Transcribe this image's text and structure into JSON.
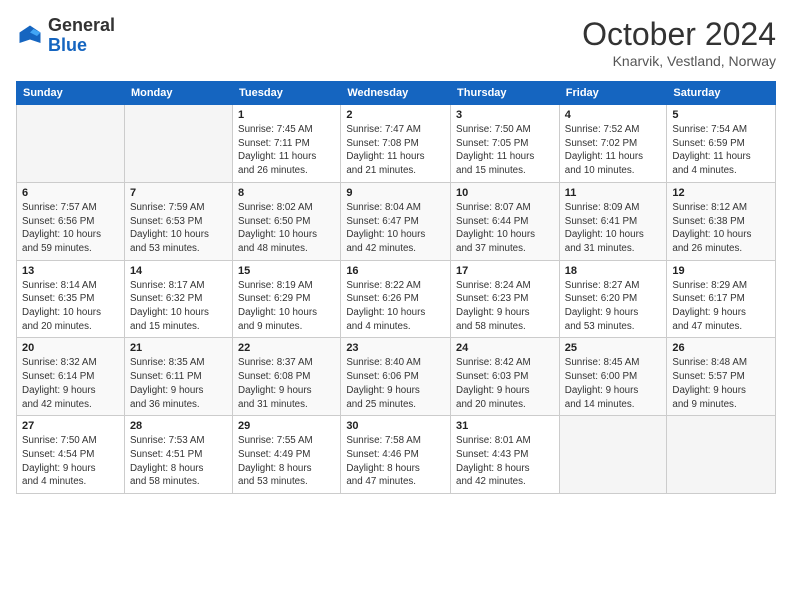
{
  "logo": {
    "line1": "General",
    "line2": "Blue"
  },
  "header": {
    "month": "October 2024",
    "location": "Knarvik, Vestland, Norway"
  },
  "weekdays": [
    "Sunday",
    "Monday",
    "Tuesday",
    "Wednesday",
    "Thursday",
    "Friday",
    "Saturday"
  ],
  "weeks": [
    [
      {
        "day": "",
        "info": ""
      },
      {
        "day": "",
        "info": ""
      },
      {
        "day": "1",
        "info": "Sunrise: 7:45 AM\nSunset: 7:11 PM\nDaylight: 11 hours\nand 26 minutes."
      },
      {
        "day": "2",
        "info": "Sunrise: 7:47 AM\nSunset: 7:08 PM\nDaylight: 11 hours\nand 21 minutes."
      },
      {
        "day": "3",
        "info": "Sunrise: 7:50 AM\nSunset: 7:05 PM\nDaylight: 11 hours\nand 15 minutes."
      },
      {
        "day": "4",
        "info": "Sunrise: 7:52 AM\nSunset: 7:02 PM\nDaylight: 11 hours\nand 10 minutes."
      },
      {
        "day": "5",
        "info": "Sunrise: 7:54 AM\nSunset: 6:59 PM\nDaylight: 11 hours\nand 4 minutes."
      }
    ],
    [
      {
        "day": "6",
        "info": "Sunrise: 7:57 AM\nSunset: 6:56 PM\nDaylight: 10 hours\nand 59 minutes."
      },
      {
        "day": "7",
        "info": "Sunrise: 7:59 AM\nSunset: 6:53 PM\nDaylight: 10 hours\nand 53 minutes."
      },
      {
        "day": "8",
        "info": "Sunrise: 8:02 AM\nSunset: 6:50 PM\nDaylight: 10 hours\nand 48 minutes."
      },
      {
        "day": "9",
        "info": "Sunrise: 8:04 AM\nSunset: 6:47 PM\nDaylight: 10 hours\nand 42 minutes."
      },
      {
        "day": "10",
        "info": "Sunrise: 8:07 AM\nSunset: 6:44 PM\nDaylight: 10 hours\nand 37 minutes."
      },
      {
        "day": "11",
        "info": "Sunrise: 8:09 AM\nSunset: 6:41 PM\nDaylight: 10 hours\nand 31 minutes."
      },
      {
        "day": "12",
        "info": "Sunrise: 8:12 AM\nSunset: 6:38 PM\nDaylight: 10 hours\nand 26 minutes."
      }
    ],
    [
      {
        "day": "13",
        "info": "Sunrise: 8:14 AM\nSunset: 6:35 PM\nDaylight: 10 hours\nand 20 minutes."
      },
      {
        "day": "14",
        "info": "Sunrise: 8:17 AM\nSunset: 6:32 PM\nDaylight: 10 hours\nand 15 minutes."
      },
      {
        "day": "15",
        "info": "Sunrise: 8:19 AM\nSunset: 6:29 PM\nDaylight: 10 hours\nand 9 minutes."
      },
      {
        "day": "16",
        "info": "Sunrise: 8:22 AM\nSunset: 6:26 PM\nDaylight: 10 hours\nand 4 minutes."
      },
      {
        "day": "17",
        "info": "Sunrise: 8:24 AM\nSunset: 6:23 PM\nDaylight: 9 hours\nand 58 minutes."
      },
      {
        "day": "18",
        "info": "Sunrise: 8:27 AM\nSunset: 6:20 PM\nDaylight: 9 hours\nand 53 minutes."
      },
      {
        "day": "19",
        "info": "Sunrise: 8:29 AM\nSunset: 6:17 PM\nDaylight: 9 hours\nand 47 minutes."
      }
    ],
    [
      {
        "day": "20",
        "info": "Sunrise: 8:32 AM\nSunset: 6:14 PM\nDaylight: 9 hours\nand 42 minutes."
      },
      {
        "day": "21",
        "info": "Sunrise: 8:35 AM\nSunset: 6:11 PM\nDaylight: 9 hours\nand 36 minutes."
      },
      {
        "day": "22",
        "info": "Sunrise: 8:37 AM\nSunset: 6:08 PM\nDaylight: 9 hours\nand 31 minutes."
      },
      {
        "day": "23",
        "info": "Sunrise: 8:40 AM\nSunset: 6:06 PM\nDaylight: 9 hours\nand 25 minutes."
      },
      {
        "day": "24",
        "info": "Sunrise: 8:42 AM\nSunset: 6:03 PM\nDaylight: 9 hours\nand 20 minutes."
      },
      {
        "day": "25",
        "info": "Sunrise: 8:45 AM\nSunset: 6:00 PM\nDaylight: 9 hours\nand 14 minutes."
      },
      {
        "day": "26",
        "info": "Sunrise: 8:48 AM\nSunset: 5:57 PM\nDaylight: 9 hours\nand 9 minutes."
      }
    ],
    [
      {
        "day": "27",
        "info": "Sunrise: 7:50 AM\nSunset: 4:54 PM\nDaylight: 9 hours\nand 4 minutes."
      },
      {
        "day": "28",
        "info": "Sunrise: 7:53 AM\nSunset: 4:51 PM\nDaylight: 8 hours\nand 58 minutes."
      },
      {
        "day": "29",
        "info": "Sunrise: 7:55 AM\nSunset: 4:49 PM\nDaylight: 8 hours\nand 53 minutes."
      },
      {
        "day": "30",
        "info": "Sunrise: 7:58 AM\nSunset: 4:46 PM\nDaylight: 8 hours\nand 47 minutes."
      },
      {
        "day": "31",
        "info": "Sunrise: 8:01 AM\nSunset: 4:43 PM\nDaylight: 8 hours\nand 42 minutes."
      },
      {
        "day": "",
        "info": ""
      },
      {
        "day": "",
        "info": ""
      }
    ]
  ]
}
